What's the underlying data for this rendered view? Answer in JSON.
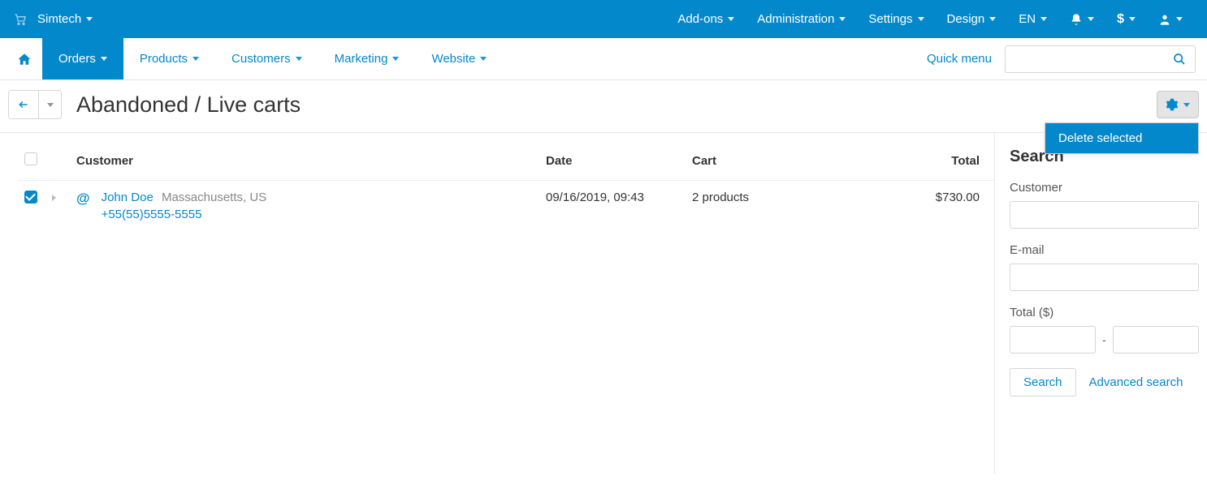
{
  "brand": "Simtech",
  "topnav": {
    "addons": "Add-ons",
    "administration": "Administration",
    "settings": "Settings",
    "design": "Design",
    "lang": "EN"
  },
  "mainnav": {
    "orders": "Orders",
    "products": "Products",
    "customers": "Customers",
    "marketing": "Marketing",
    "website": "Website",
    "quick_menu": "Quick menu"
  },
  "page": {
    "title": "Abandoned / Live carts"
  },
  "gear_menu": {
    "delete_selected": "Delete selected"
  },
  "table": {
    "headers": {
      "customer": "Customer",
      "date": "Date",
      "cart": "Cart",
      "total": "Total"
    },
    "rows": [
      {
        "checked": true,
        "customer_name": "John Doe",
        "customer_location": "Massachusetts, US",
        "customer_phone": "+55(55)5555-5555",
        "date": "09/16/2019, 09:43",
        "cart": "2 products",
        "total": "$730.00"
      }
    ]
  },
  "sidebar": {
    "title": "Search",
    "customer_label": "Customer",
    "email_label": "E-mail",
    "total_label": "Total ($)",
    "dash": "-",
    "search_btn": "Search",
    "advanced": "Advanced search"
  }
}
